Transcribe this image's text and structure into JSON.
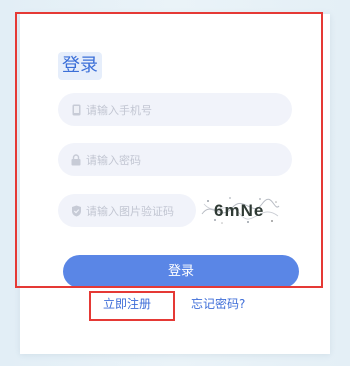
{
  "login_title": "登录",
  "phone": {
    "placeholder": "请输入手机号",
    "icon": "phone-icon"
  },
  "password": {
    "placeholder": "请输入密码",
    "icon": "lock-icon"
  },
  "captcha_field": {
    "placeholder": "请输入图片验证码",
    "icon": "shield-icon"
  },
  "captcha_text": "6mNe",
  "login_button": "登录",
  "links": {
    "register": "立即注册",
    "forgot": "忘记密码?"
  },
  "colors": {
    "accent": "#5a86e6",
    "link": "#3f6ed8",
    "highlight": "#e53935",
    "input_bg": "#f1f3fa"
  }
}
